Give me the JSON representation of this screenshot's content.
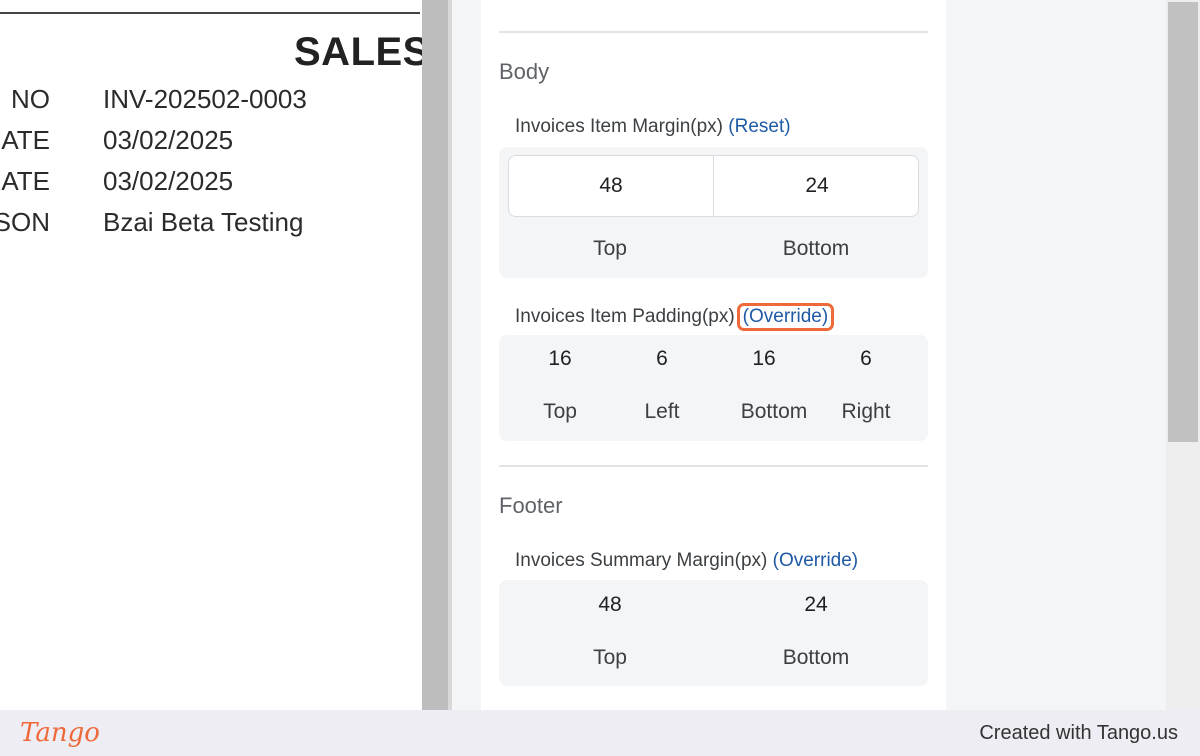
{
  "preview": {
    "title": "SALES",
    "rows": [
      {
        "label": "NO",
        "value": "INV-202502-0003"
      },
      {
        "label": "ATE",
        "value": "03/02/2025"
      },
      {
        "label": "ATE",
        "value": "03/02/2025"
      },
      {
        "label": "SON",
        "value": "Bzai Beta Testing"
      }
    ]
  },
  "body_section": {
    "title": "Body",
    "item_margin": {
      "label": "Invoices Item Margin(px)",
      "action": "(Reset)",
      "top": "48",
      "bottom": "24",
      "top_label": "Top",
      "bottom_label": "Bottom"
    },
    "item_padding": {
      "label": "Invoices Item Padding(px)",
      "action": "(Override)",
      "values": [
        "16",
        "6",
        "16",
        "6"
      ],
      "captions": [
        "Top",
        "Left",
        "Bottom",
        "Right"
      ]
    }
  },
  "footer_section": {
    "title": "Footer",
    "summary_margin": {
      "label": "Invoices Summary Margin(px)",
      "action": "(Override)",
      "top": "48",
      "bottom": "24",
      "top_label": "Top",
      "bottom_label": "Bottom"
    }
  },
  "footer_bar": {
    "brand": "Tango",
    "credit": "Created with Tango.us"
  },
  "colors": {
    "link": "#1f5aa6",
    "highlight": "#ef6a3a"
  }
}
